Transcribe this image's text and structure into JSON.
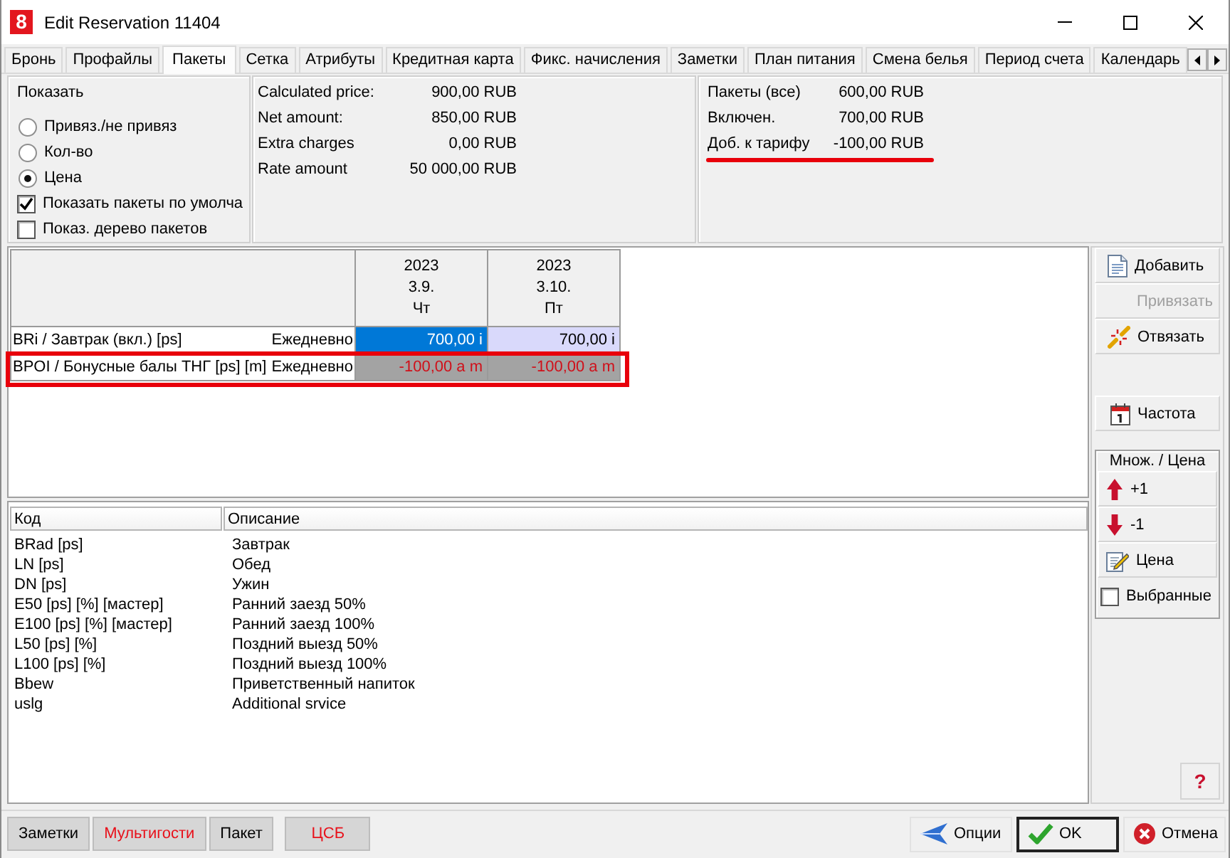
{
  "window": {
    "icon_label": "8",
    "title": "Edit Reservation 11404"
  },
  "tabs": [
    {
      "label": "Бронь",
      "selected": false
    },
    {
      "label": "Профайлы",
      "selected": false
    },
    {
      "label": "Пакеты",
      "selected": true
    },
    {
      "label": "Сетка",
      "selected": false
    },
    {
      "label": "Атрибуты",
      "selected": false
    },
    {
      "label": "Кредитная карта",
      "selected": false
    },
    {
      "label": "Фикс. начисления",
      "selected": false
    },
    {
      "label": "Заметки",
      "selected": false
    },
    {
      "label": "План питания",
      "selected": false
    },
    {
      "label": "Смена белья",
      "selected": false
    },
    {
      "label": "Период счета",
      "selected": false
    },
    {
      "label": "Календарь",
      "selected": false
    }
  ],
  "show_options": {
    "title": "Показать",
    "radios": [
      {
        "label": "Привяз./не привяз",
        "selected": false
      },
      {
        "label": "Кол-во",
        "selected": false
      },
      {
        "label": "Цена",
        "selected": true
      }
    ],
    "checkboxes": [
      {
        "label": "Показать пакеты по умолча",
        "checked": true
      },
      {
        "label": "Показ. дерево пакетов",
        "checked": false
      }
    ]
  },
  "price_summary": [
    {
      "label": "Calculated price:",
      "value": "900,00 RUB"
    },
    {
      "label": "Net amount:",
      "value": "850,00 RUB"
    },
    {
      "label": "Extra charges",
      "value": "0,00 RUB"
    },
    {
      "label": "Rate amount",
      "value": "50 000,00 RUB"
    }
  ],
  "package_summary": [
    {
      "label": "Пакеты (все)",
      "value": "600,00 RUB",
      "marked": false
    },
    {
      "label": "Включен.",
      "value": "700,00 RUB",
      "marked": false
    },
    {
      "label": "Доб. к тарифу",
      "value": "-100,00 RUB",
      "marked": true
    }
  ],
  "package_grid": {
    "columns": [
      {
        "year": "2023",
        "date": "3.9.",
        "weekday": "Чт"
      },
      {
        "year": "2023",
        "date": "3.10.",
        "weekday": "Пт"
      }
    ],
    "rows": [
      {
        "name": "BRi / Завтрак (вкл.) [ps]",
        "frequency": "Ежедневно",
        "kind": "included",
        "marked": false,
        "cells": [
          {
            "value": "700,00 i",
            "selected": true
          },
          {
            "value": "700,00 i",
            "selected": false
          }
        ]
      },
      {
        "name": "BPOI / Бонусные балы ТНГ [ps] [m]",
        "frequency": "Ежедневно",
        "kind": "adjustment",
        "marked": true,
        "cells": [
          {
            "value": "-100,00 a m",
            "selected": false
          },
          {
            "value": "-100,00 a m",
            "selected": false
          }
        ]
      }
    ]
  },
  "package_list": {
    "columns": [
      "Код",
      "Описание"
    ],
    "rows": [
      [
        "BRad [ps]",
        "Завтрак"
      ],
      [
        "LN [ps]",
        "Обед"
      ],
      [
        "DN [ps]",
        "Ужин"
      ],
      [
        "E50 [ps] [%] [мастер]",
        "Ранний заезд 50%"
      ],
      [
        "E100 [ps] [%] [мастер]",
        "Ранний заезд 100%"
      ],
      [
        "L50 [ps] [%]",
        "Поздний выезд 50%"
      ],
      [
        "L100 [ps] [%]",
        "Поздний выезд 100%"
      ],
      [
        "Bbew",
        "Приветственный напиток"
      ],
      [
        "uslg",
        "Additional srvice"
      ]
    ]
  },
  "actions": {
    "add": {
      "label": "Добавить",
      "disabled": false
    },
    "link": {
      "label": "Привязать",
      "disabled": true
    },
    "unlink": {
      "label": "Отвязать",
      "disabled": false
    },
    "frequency": {
      "label": "Частота",
      "disabled": false
    }
  },
  "quantity_price": {
    "title": "Множ. / Цена",
    "increase": {
      "label": "+1"
    },
    "decrease": {
      "label": "-1"
    },
    "price": {
      "label": "Цена"
    },
    "selected_only": {
      "label": "Выбранные",
      "checked": false
    }
  },
  "help_button": {
    "label": "?"
  },
  "footer": {
    "left": [
      {
        "label": "Заметки",
        "alert": false
      },
      {
        "label": "Мультигости",
        "alert": true
      },
      {
        "label": "Пакет",
        "alert": false
      },
      {
        "label": "ЦСБ",
        "alert": true
      }
    ],
    "options": {
      "label": "Опции"
    },
    "ok": {
      "label": "OK"
    },
    "cancel": {
      "label": "Отмена"
    }
  }
}
